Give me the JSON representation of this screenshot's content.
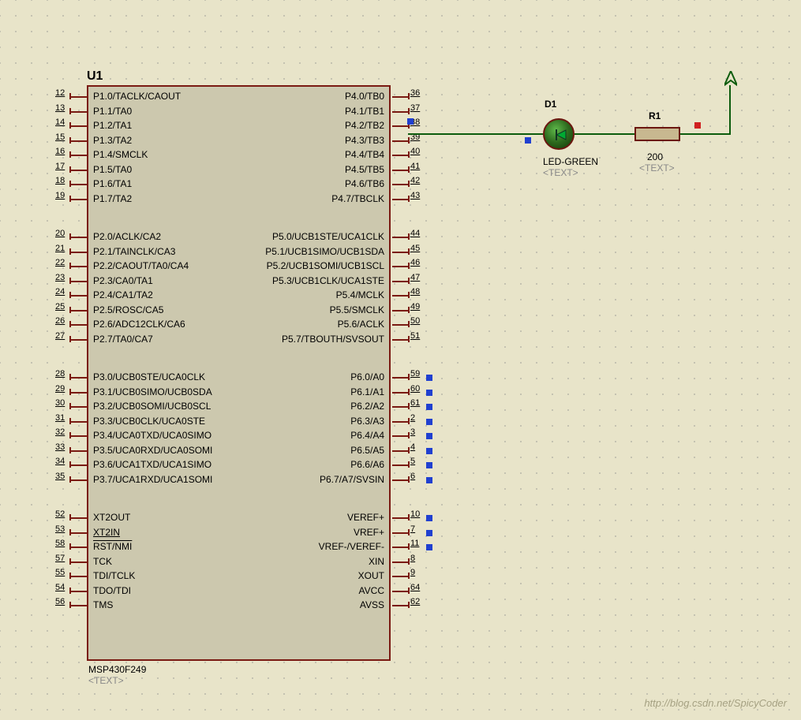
{
  "u1": {
    "ref": "U1",
    "part": "MSP430F249",
    "text_placeholder": "<TEXT>",
    "pins_left": [
      {
        "num": "12",
        "label": "P1.0/TACLK/CAOUT"
      },
      {
        "num": "13",
        "label": "P1.1/TA0"
      },
      {
        "num": "14",
        "label": "P1.2/TA1"
      },
      {
        "num": "15",
        "label": "P1.3/TA2"
      },
      {
        "num": "16",
        "label": "P1.4/SMCLK"
      },
      {
        "num": "17",
        "label": "P1.5/TA0"
      },
      {
        "num": "18",
        "label": "P1.6/TA1"
      },
      {
        "num": "19",
        "label": "P1.7/TA2"
      },
      {
        "gap": true
      },
      {
        "num": "20",
        "label": "P2.0/ACLK/CA2"
      },
      {
        "num": "21",
        "label": "P2.1/TAINCLK/CA3"
      },
      {
        "num": "22",
        "label": "P2.2/CAOUT/TA0/CA4"
      },
      {
        "num": "23",
        "label": "P2.3/CA0/TA1"
      },
      {
        "num": "24",
        "label": "P2.4/CA1/TA2"
      },
      {
        "num": "25",
        "label": "P2.5/ROSC/CA5"
      },
      {
        "num": "26",
        "label": "P2.6/ADC12CLK/CA6"
      },
      {
        "num": "27",
        "label": "P2.7/TA0/CA7"
      },
      {
        "gap": true
      },
      {
        "num": "28",
        "label": "P3.0/UCB0STE/UCA0CLK"
      },
      {
        "num": "29",
        "label": "P3.1/UCB0SIMO/UCB0SDA"
      },
      {
        "num": "30",
        "label": "P3.2/UCB0SOMI/UCB0SCL"
      },
      {
        "num": "31",
        "label": "P3.3/UCB0CLK/UCA0STE"
      },
      {
        "num": "32",
        "label": "P3.4/UCA0TXD/UCA0SIMO"
      },
      {
        "num": "33",
        "label": "P3.5/UCA0RXD/UCA0SOMI"
      },
      {
        "num": "34",
        "label": "P3.6/UCA1TXD/UCA1SIMO"
      },
      {
        "num": "35",
        "label": "P3.7/UCA1RXD/UCA1SOMI"
      },
      {
        "gap": true
      },
      {
        "num": "52",
        "label": "XT2OUT"
      },
      {
        "num": "53",
        "label": "XT2IN",
        "underline": true
      },
      {
        "num": "58",
        "label": "RST/NMI",
        "overline": true
      },
      {
        "num": "57",
        "label": "TCK"
      },
      {
        "num": "55",
        "label": "TDI/TCLK"
      },
      {
        "num": "54",
        "label": "TDO/TDI"
      },
      {
        "num": "56",
        "label": "TMS"
      }
    ],
    "pins_right": [
      {
        "num": "36",
        "label": "P4.0/TB0"
      },
      {
        "num": "37",
        "label": "P4.1/TB1"
      },
      {
        "num": "38",
        "label": "P4.2/TB2",
        "node": "blue-before"
      },
      {
        "num": "39",
        "label": "P4.3/TB3"
      },
      {
        "num": "40",
        "label": "P4.4/TB4"
      },
      {
        "num": "41",
        "label": "P4.5/TB5"
      },
      {
        "num": "42",
        "label": "P4.6/TB6"
      },
      {
        "num": "43",
        "label": "P4.7/TBCLK"
      },
      {
        "gap": true
      },
      {
        "num": "44",
        "label": "P5.0/UCB1STE/UCA1CLK"
      },
      {
        "num": "45",
        "label": "P5.1/UCB1SIMO/UCB1SDA"
      },
      {
        "num": "46",
        "label": "P5.2/UCB1SOMI/UCB1SCL"
      },
      {
        "num": "47",
        "label": "P5.3/UCB1CLK/UCA1STE"
      },
      {
        "num": "48",
        "label": "P5.4/MCLK"
      },
      {
        "num": "49",
        "label": "P5.5/SMCLK"
      },
      {
        "num": "50",
        "label": "P5.6/ACLK"
      },
      {
        "num": "51",
        "label": "P5.7/TBOUTH/SVSOUT"
      },
      {
        "gap": true
      },
      {
        "num": "59",
        "label": "P6.0/A0",
        "node": "blue"
      },
      {
        "num": "60",
        "label": "P6.1/A1",
        "node": "blue"
      },
      {
        "num": "61",
        "label": "P6.2/A2",
        "node": "blue"
      },
      {
        "num": "2",
        "label": "P6.3/A3",
        "node": "blue"
      },
      {
        "num": "3",
        "label": "P6.4/A4",
        "node": "blue"
      },
      {
        "num": "4",
        "label": "P6.5/A5",
        "node": "blue"
      },
      {
        "num": "5",
        "label": "P6.6/A6",
        "node": "blue"
      },
      {
        "num": "6",
        "label": "P6.7/A7/SVSIN",
        "node": "blue"
      },
      {
        "gap": true
      },
      {
        "num": "10",
        "label": "VEREF+",
        "node": "blue"
      },
      {
        "num": "7",
        "label": "VREF+",
        "node": "blue"
      },
      {
        "num": "11",
        "label": "VREF-/VEREF-",
        "node": "blue"
      },
      {
        "num": "8",
        "label": "XIN"
      },
      {
        "num": "9",
        "label": "XOUT"
      },
      {
        "num": "64",
        "label": "AVCC"
      },
      {
        "num": "62",
        "label": "AVSS"
      }
    ]
  },
  "d1": {
    "ref": "D1",
    "label": "LED-GREEN",
    "text": "<TEXT>"
  },
  "r1": {
    "ref": "R1",
    "value": "200",
    "text": "<TEXT>"
  },
  "watermark": "http://blog.csdn.net/SpicyCoder"
}
